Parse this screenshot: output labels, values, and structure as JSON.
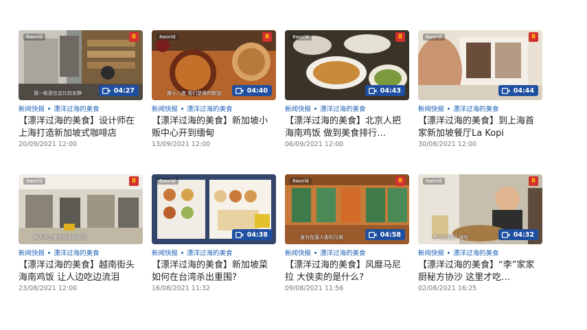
{
  "cards": [
    {
      "badge": "8",
      "subtitle": "我一般是在这比较安静",
      "duration": "04:27",
      "category": "新闻快报",
      "series": "漂洋过海的美食",
      "title": "【漂洋过海的美食】设计师在上海打造新加坡式咖啡店",
      "date": "20/09/2021 12:00"
    },
    {
      "badge": "8",
      "subtitle": "南十八度 我们是做的新加",
      "duration": "04:40",
      "category": "新闻快报",
      "series": "漂洋过海的美食",
      "title": "【漂洋过海的美食】新加坡小贩中心开到缅甸",
      "date": "13/09/2021 12:00"
    },
    {
      "badge": "8",
      "subtitle": "",
      "duration": "04:43",
      "category": "新闻快报",
      "series": "漂洋过海的美食",
      "title": "【漂洋过海的美食】北京人把海南鸡饭 做到美食排行…",
      "date": "06/09/2021 12:00"
    },
    {
      "badge": "8",
      "subtitle": "",
      "duration": "04:44",
      "category": "新闻快报",
      "series": "漂洋过海的美食",
      "title": "【漂洋过海的美食】到上海首家新加坡餐厅La Kopi",
      "date": "30/08/2021 12:00"
    },
    {
      "badge": "8",
      "subtitle": "每天早上都有很多顾客的",
      "duration": "",
      "category": "新闻快报",
      "series": "漂洋过海的美食",
      "title": "【漂洋过海的美食】越南街头海南鸡饭 让人边吃边流泪",
      "date": "23/08/2021 12:00"
    },
    {
      "badge": "",
      "subtitle": "",
      "duration": "04:38",
      "category": "新闻快报",
      "series": "漂洋过海的美食",
      "title": "【漂洋过海的美食】新加坡菜如何在台湾杀出重围?",
      "date": "16/08/2021 11:32"
    },
    {
      "badge": "8",
      "subtitle": "身为在唐人街的马来",
      "duration": "04:58",
      "category": "新闻快报",
      "series": "漂洋过海的美食",
      "title": "【漂洋过海的美食】风靡马尼拉 大侠卖的是什么?",
      "date": "09/08/2021 11:56"
    },
    {
      "badge": "8",
      "subtitle": "都长得很好 很吃",
      "duration": "04:32",
      "category": "新闻快报",
      "series": "漂洋过海的美食",
      "title": "【漂洋过海的美食】“李”家家厨秘方协沙 这里才吃…",
      "date": "02/08/2021 16:25"
    }
  ],
  "colors": {
    "accent": "#1a5fb4",
    "duration_badge": "#1e4fa0",
    "date_text": "#777777"
  },
  "icons": {
    "duration": "video-camera-icon",
    "channel_logo": "channel-8-logo"
  }
}
